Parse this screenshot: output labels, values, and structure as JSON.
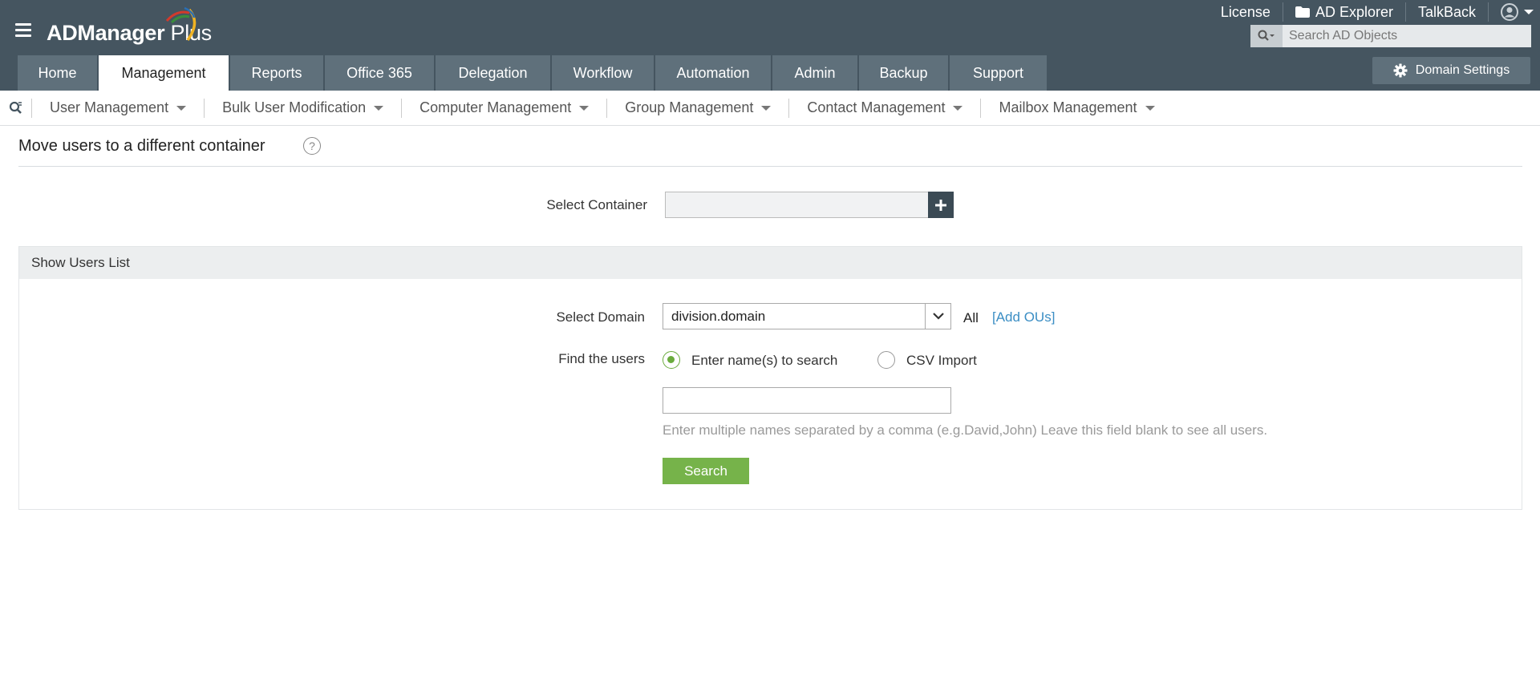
{
  "app": {
    "logo_text_bold": "ADManager",
    "logo_text_light": " Plus"
  },
  "header": {
    "links": [
      "License",
      "AD Explorer",
      "TalkBack"
    ],
    "search_placeholder": "Search AD Objects",
    "domain_settings_label": "Domain Settings"
  },
  "tabs": [
    {
      "label": "Home",
      "active": false
    },
    {
      "label": "Management",
      "active": true
    },
    {
      "label": "Reports",
      "active": false
    },
    {
      "label": "Office 365",
      "active": false
    },
    {
      "label": "Delegation",
      "active": false
    },
    {
      "label": "Workflow",
      "active": false
    },
    {
      "label": "Automation",
      "active": false
    },
    {
      "label": "Admin",
      "active": false
    },
    {
      "label": "Backup",
      "active": false
    },
    {
      "label": "Support",
      "active": false
    }
  ],
  "subnav": [
    "User Management",
    "Bulk User Modification",
    "Computer Management",
    "Group Management",
    "Contact Management",
    "Mailbox Management"
  ],
  "page": {
    "title": "Move users to a different container",
    "select_container_label": "Select Container",
    "select_container_value": "",
    "panel_title": "Show Users List",
    "select_domain_label": "Select Domain",
    "select_domain_value": "division.domain",
    "all_label": "All",
    "add_ous_label": "[Add OUs]",
    "find_users_label": "Find the users",
    "radio_options": [
      {
        "label": "Enter name(s) to search",
        "checked": true
      },
      {
        "label": "CSV Import",
        "checked": false
      }
    ],
    "names_value": "",
    "hint": "Enter multiple names separated by a comma (e.g.David,John) Leave this field blank to see all users.",
    "search_button": "Search"
  },
  "colors": {
    "header_bg": "#455560",
    "tab_bg": "#5f707b",
    "accent_green": "#76b34a",
    "link_blue": "#3b8ec4"
  }
}
